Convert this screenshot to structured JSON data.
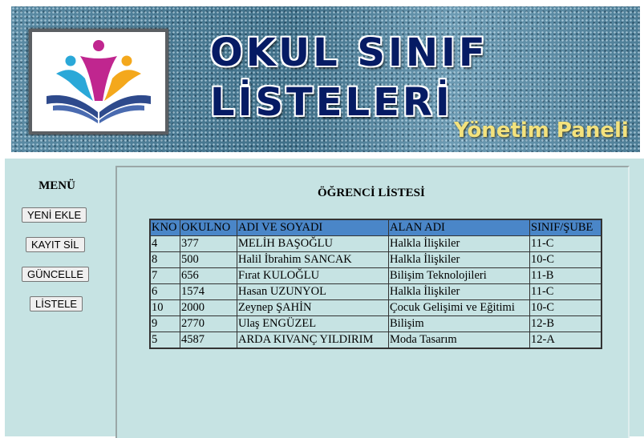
{
  "banner": {
    "title_line1": "OKUL SINIF",
    "title_line2": "LİSTELERİ",
    "subtitle": "Yönetim Paneli",
    "logo_icon": "school-logo-icon"
  },
  "menu": {
    "title": "MENÜ",
    "buttons": [
      {
        "label": "YENİ EKLE"
      },
      {
        "label": "KAYIT SİL"
      },
      {
        "label": "GÜNCELLE"
      },
      {
        "label": "LİSTELE"
      }
    ]
  },
  "list": {
    "title": "ÖĞRENCİ LİSTESİ",
    "columns": [
      "KNO",
      "OKULNO",
      "ADI VE SOYADI",
      "ALAN ADI",
      "SINIF/ŞUBE"
    ],
    "rows": [
      [
        "4",
        "377",
        "MELİH BAŞOĞLU",
        "Halkla İlişkiler",
        "11-C"
      ],
      [
        "8",
        "500",
        "Halil İbrahim SANCAK",
        "Halkla İlişkiler",
        "10-C"
      ],
      [
        "7",
        "656",
        "Fırat KULOĞLU",
        "Bilişim Teknolojileri",
        "11-B"
      ],
      [
        "6",
        "1574",
        "Hasan UZUNYOL",
        "Halkla İlişkiler",
        "11-C"
      ],
      [
        "10",
        "2000",
        "Zeynep ŞAHİN",
        "Çocuk Gelişimi ve Eğitimi",
        "10-C"
      ],
      [
        "9",
        "2770",
        "Ulaş ENGÜZEL",
        "Bilişim",
        "12-B"
      ],
      [
        "5",
        "4587",
        "ARDA KIVANÇ YILDIRIM",
        "Moda Tasarım",
        "12-A"
      ]
    ]
  },
  "colors": {
    "title_text": "#061b64",
    "subtitle_text": "#f3e27d",
    "panel_bg": "#c6e3e3",
    "table_header_bg": "#4a86c8"
  }
}
